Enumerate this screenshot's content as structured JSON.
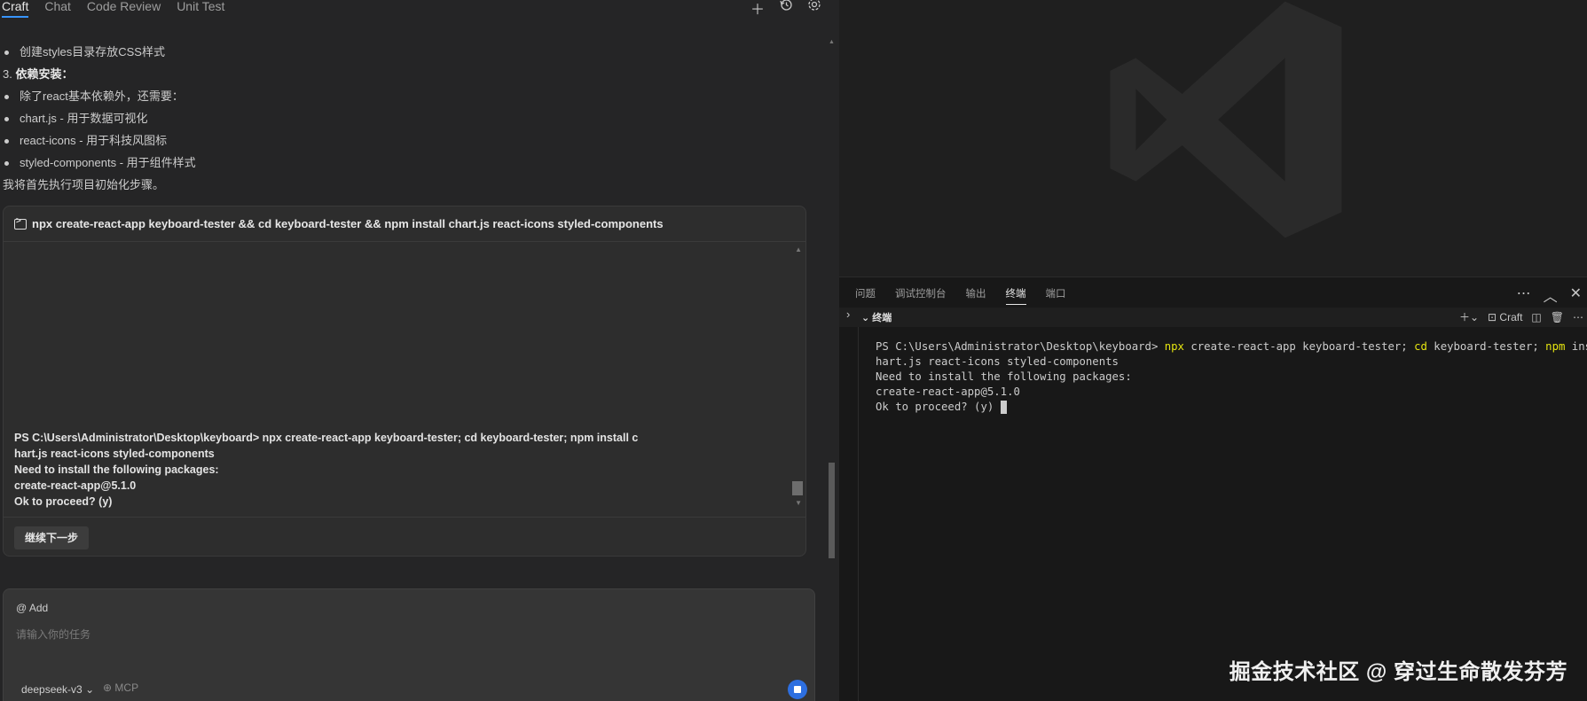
{
  "left_panel": {
    "tabs": [
      {
        "label": "Craft",
        "active": true
      },
      {
        "label": "Chat",
        "active": false
      },
      {
        "label": "Code Review",
        "active": false
      },
      {
        "label": "Unit Test",
        "active": false
      }
    ],
    "header_icons": [
      "plus-icon",
      "history-icon",
      "settings-icon"
    ],
    "message_lines": [
      {
        "type": "bullet",
        "text": "创建styles目录存放CSS样式"
      },
      {
        "type": "numbered",
        "number": "3.",
        "bold": "依赖安装",
        "suffix": "："
      },
      {
        "type": "bullet",
        "text": "除了react基本依赖外，还需要："
      },
      {
        "type": "bullet",
        "text": "chart.js - 用于数据可视化"
      },
      {
        "type": "bullet",
        "text": "react-icons - 用于科技风图标"
      },
      {
        "type": "bullet",
        "text": "styled-components - 用于组件样式"
      },
      {
        "type": "plain",
        "text": "我将首先执行项目初始化步骤。"
      }
    ],
    "command_card": {
      "command": "npx create-react-app keyboard-tester && cd keyboard-tester && npm install chart.js react-icons styled-components",
      "output_lines": [
        "PS C:\\Users\\Administrator\\Desktop\\keyboard> npx create-react-app keyboard-tester; cd keyboard-tester; npm install c",
        "hart.js react-icons styled-components",
        "Need to install the following packages:",
        "create-react-app@5.1.0",
        "Ok to proceed? (y)"
      ],
      "continue_label": "继续下一步"
    },
    "input": {
      "add_label": "@ Add",
      "placeholder": "请输入你的任务",
      "value": "",
      "model": "deepseek-v3",
      "mcp_label": "MCP"
    }
  },
  "right_panel": {
    "panel_tabs": [
      {
        "label": "问题",
        "active": false
      },
      {
        "label": "调试控制台",
        "active": false
      },
      {
        "label": "输出",
        "active": false
      },
      {
        "label": "终端",
        "active": true
      },
      {
        "label": "端口",
        "active": false
      }
    ],
    "terminal_title": "终端",
    "terminal_profile": "Craft",
    "terminal": {
      "prompt": "PS C:\\Users\\Administrator\\Desktop\\keyboard> ",
      "line1_parts": [
        {
          "text": "npx",
          "color": "yellow"
        },
        {
          "text": " create-react-app keyboard-tester; ",
          "color": "default"
        },
        {
          "text": "cd",
          "color": "yellow"
        },
        {
          "text": " keyboard-tester; ",
          "color": "default"
        },
        {
          "text": "npm",
          "color": "yellow"
        },
        {
          "text": " install c",
          "color": "default"
        }
      ],
      "lines": [
        "hart.js react-icons styled-components",
        "Need to install the following packages:",
        "create-react-app@5.1.0",
        "Ok to proceed? (y) "
      ]
    }
  },
  "watermark": "掘金技术社区 @ 穿过生命散发芬芳",
  "colors": {
    "accent_blue": "#2d6fe0",
    "terminal_keyword_yellow": "#e5e510",
    "background": "#1f1f1f"
  }
}
